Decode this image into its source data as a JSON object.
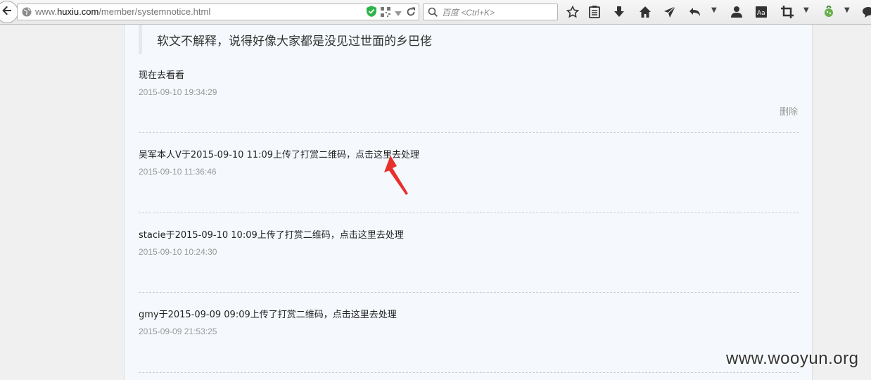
{
  "browser": {
    "url_prefix": "www.",
    "url_domain": "huxiu.com",
    "url_path": "/member/systemnotice.html",
    "search_placeholder": "百度 <Ctrl+K>"
  },
  "content": {
    "quote": "软文不解释，说得好像大家都是没见过世面的乡巴佬",
    "notices": [
      {
        "text": "现在去看看",
        "time": "2015-09-10 19:34:29",
        "delete_label": "删除"
      },
      {
        "text": "吴军本人V于2015-09-10 11:09上传了打赏二维码，点击这里去处理",
        "time": "2015-09-10 11:36:46"
      },
      {
        "text": "stacie于2015-09-10 10:09上传了打赏二维码，点击这里去处理",
        "time": "2015-09-10 10:24:30"
      },
      {
        "text": "gmy于2015-09-09 09:09上传了打赏二维码，点击这里去处理",
        "time": "2015-09-09 21:53:25"
      }
    ]
  },
  "watermark": "www.wooyun.org",
  "colors": {
    "annotation_arrow": "#e8302c",
    "page_background": "#f5f9fd",
    "shield": "#2fb44a"
  },
  "icons": [
    "back-arrow-icon",
    "globe-icon",
    "shield-icon",
    "qr-code-icon",
    "dropdown-icon",
    "reload-icon",
    "search-icon",
    "bookmark-star-icon",
    "reading-list-icon",
    "download-icon",
    "home-icon",
    "send-icon",
    "undo-icon",
    "user-icon",
    "reader-mode-icon",
    "crop-icon",
    "extension-icon",
    "chat-icon"
  ]
}
